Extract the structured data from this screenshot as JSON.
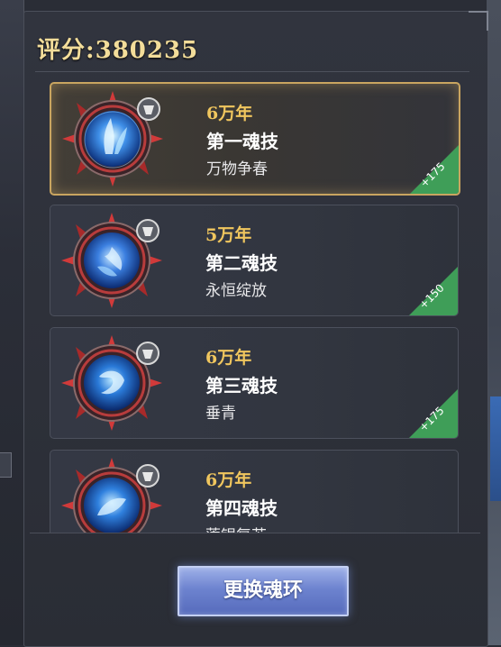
{
  "score": {
    "label": "评分:",
    "value": "380235"
  },
  "skills": [
    {
      "years": "6万年",
      "name": "第一魂技",
      "desc": "万物争春",
      "bonus": "+175",
      "selected": true
    },
    {
      "years": "5万年",
      "name": "第二魂技",
      "desc": "永恒绽放",
      "bonus": "+150",
      "selected": false
    },
    {
      "years": "6万年",
      "name": "第三魂技",
      "desc": "垂青",
      "bonus": "+175",
      "selected": false
    },
    {
      "years": "6万年",
      "name": "第四魂技",
      "desc": "莲银复苏",
      "bonus": "",
      "selected": false
    }
  ],
  "button": {
    "label": "更换魂环"
  },
  "colors": {
    "gold": "#f0c65e",
    "bonus_green": "#3f9e58",
    "button_blue": "#6d83cf"
  }
}
